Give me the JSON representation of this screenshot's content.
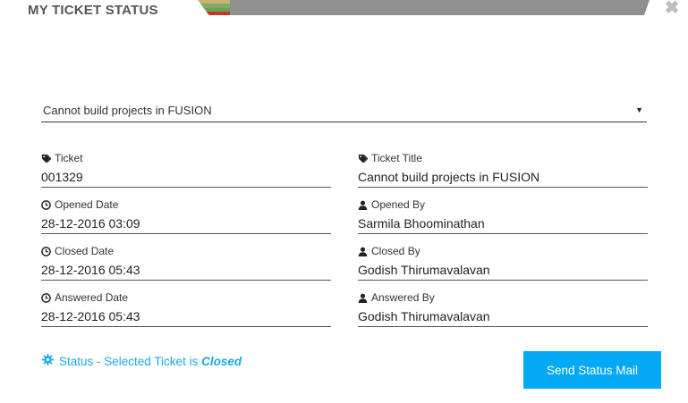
{
  "header": {
    "title": "MY TICKET STATUS",
    "stripe_colors": [
      "#c9b36f",
      "#7cab6c",
      "#6e9e55",
      "#c0392b"
    ]
  },
  "select": {
    "value": "Cannot build projects in FUSION"
  },
  "fields": {
    "ticket": {
      "label": "Ticket",
      "value": "001329",
      "icon": "tag-icon"
    },
    "ticket_title": {
      "label": "Ticket Title",
      "value": "Cannot build projects in FUSION",
      "icon": "tag-icon"
    },
    "opened_date": {
      "label": "Opened Date",
      "value": "28-12-2016 03:09",
      "icon": "clock-icon"
    },
    "opened_by": {
      "label": "Opened By",
      "value": "Sarmila Bhoominathan",
      "icon": "user-icon"
    },
    "closed_date": {
      "label": "Closed Date",
      "value": "28-12-2016 05:43",
      "icon": "clock-icon"
    },
    "closed_by": {
      "label": "Closed By",
      "value": "Godish Thirumavalavan",
      "icon": "user-icon"
    },
    "answered_date": {
      "label": "Answered Date",
      "value": "28-12-2016 05:43",
      "icon": "clock-icon"
    },
    "answered_by": {
      "label": "Answered By",
      "value": "Godish Thirumavalavan",
      "icon": "user-icon"
    }
  },
  "status": {
    "prefix": "Status - Selected Ticket is ",
    "value": "Closed",
    "color": "#19a9e5"
  },
  "actions": {
    "send_label": "Send Status Mail",
    "accent": "#03a9f4"
  }
}
